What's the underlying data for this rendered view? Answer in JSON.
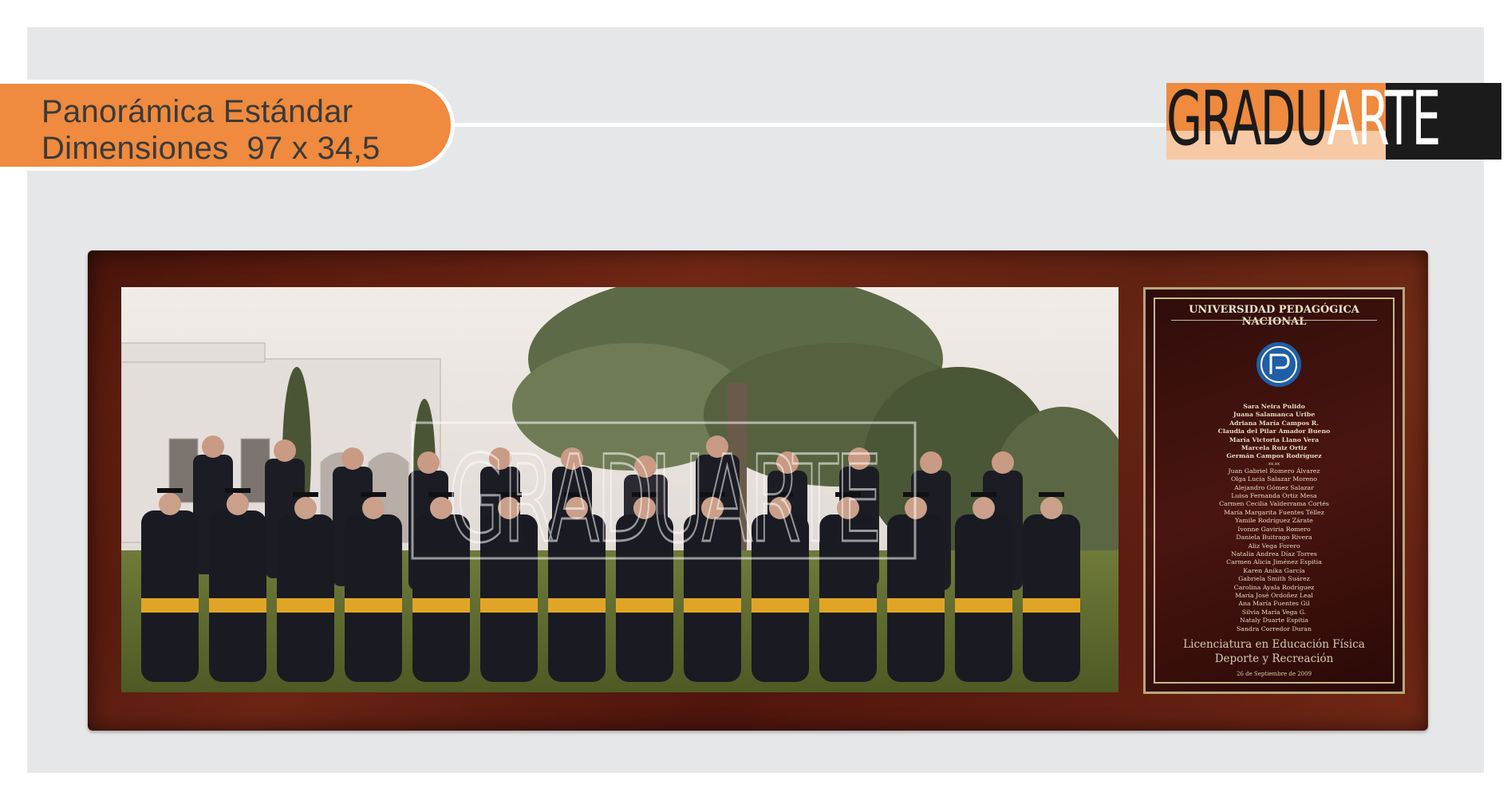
{
  "header": {
    "title_line1": "Panorámica Estándar",
    "title_line2": "Dimensiones  97 x 34,5"
  },
  "logo": {
    "part1": "GRADU",
    "part2": "ARTE"
  },
  "watermark": "GRADUARTE",
  "plaque": {
    "university": "UNIVERSIDAD PEDAGÓGICA NACIONAL",
    "staff": [
      "Sara Neira Pulido",
      "Juana Salamanca Uribe",
      "Adriana María Campos R.",
      "Claudia del Pilar Amador Bueno",
      "María Victoria Llano Vera",
      "Marcela Ruiz Ortiz",
      "Germán Campos Rodríguez"
    ],
    "separator": "xx.xx",
    "graduates": [
      "Juan Gabriel Romero Álvarez",
      "Olga Lucía Salazar Moreno",
      "Alejandro Gómez Salazar",
      "Luisa Fernanda Ortiz Mesa",
      "Carmen Cecilia Valderrama Cortés",
      "María Margarita Fuentes Téllez",
      "Yamile Rodríguez Zárate",
      "Ivonne Gaviria Romero",
      "Daniela Buitrago Rivera",
      "Aliz Vega Forero",
      "Natalia Andrea Díaz Torres",
      "Carmen Alicia Jiménez Espitia",
      "Karen Anika García",
      "Gabriela Smith Suárez",
      "Carolina Ayala Rodríguez",
      "María José Ordoñez Leal",
      "Ana María Fuentes Gil",
      "Silvia María Vega G.",
      "Nataly Duarte Espitia",
      "Sandra Corredor Duran"
    ],
    "program_line1": "Licenciatura en Educación Física",
    "program_line2": "Deporte y Recreación",
    "date": "26 de Septiembre de 2009"
  },
  "colors": {
    "accent_orange": "#ef8a3e",
    "background": "#e6e7e9",
    "logo_dark": "#1b1b1b"
  }
}
